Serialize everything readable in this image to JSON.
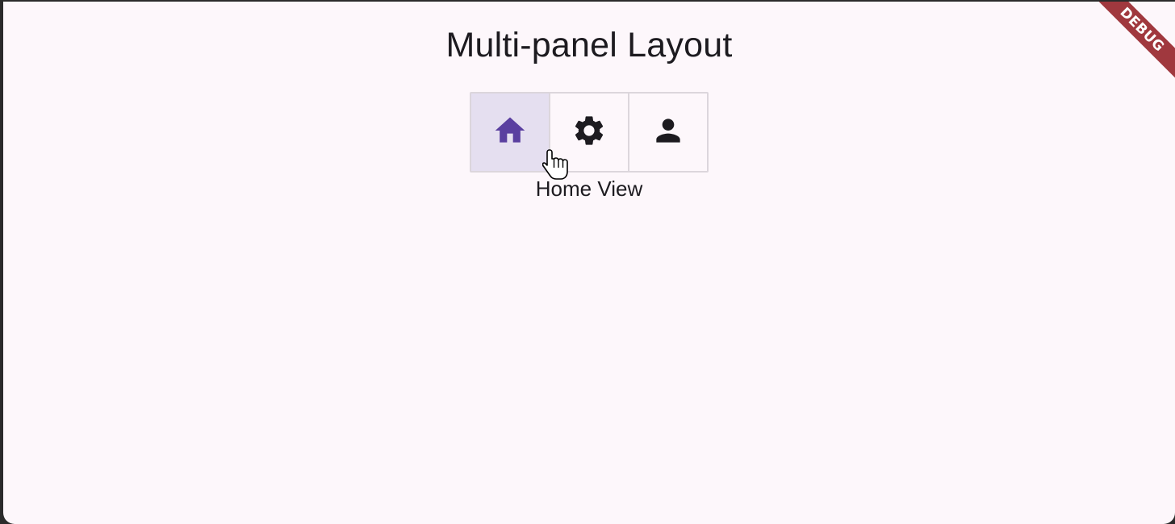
{
  "app": {
    "title": "Multi-panel Layout",
    "debug_banner": "DEBUG"
  },
  "toggles": [
    {
      "icon": "home-icon",
      "selected": true
    },
    {
      "icon": "gear-icon",
      "selected": false
    },
    {
      "icon": "person-icon",
      "selected": false
    }
  ],
  "view": {
    "label": "Home View"
  },
  "colors": {
    "background": "#fdf7fb",
    "selected_bg": "#e5dff0",
    "selected_icon": "#5a3fa0",
    "icon": "#1d1b20",
    "border": "#dcd6dc",
    "debug_banner": "#a0383e"
  }
}
